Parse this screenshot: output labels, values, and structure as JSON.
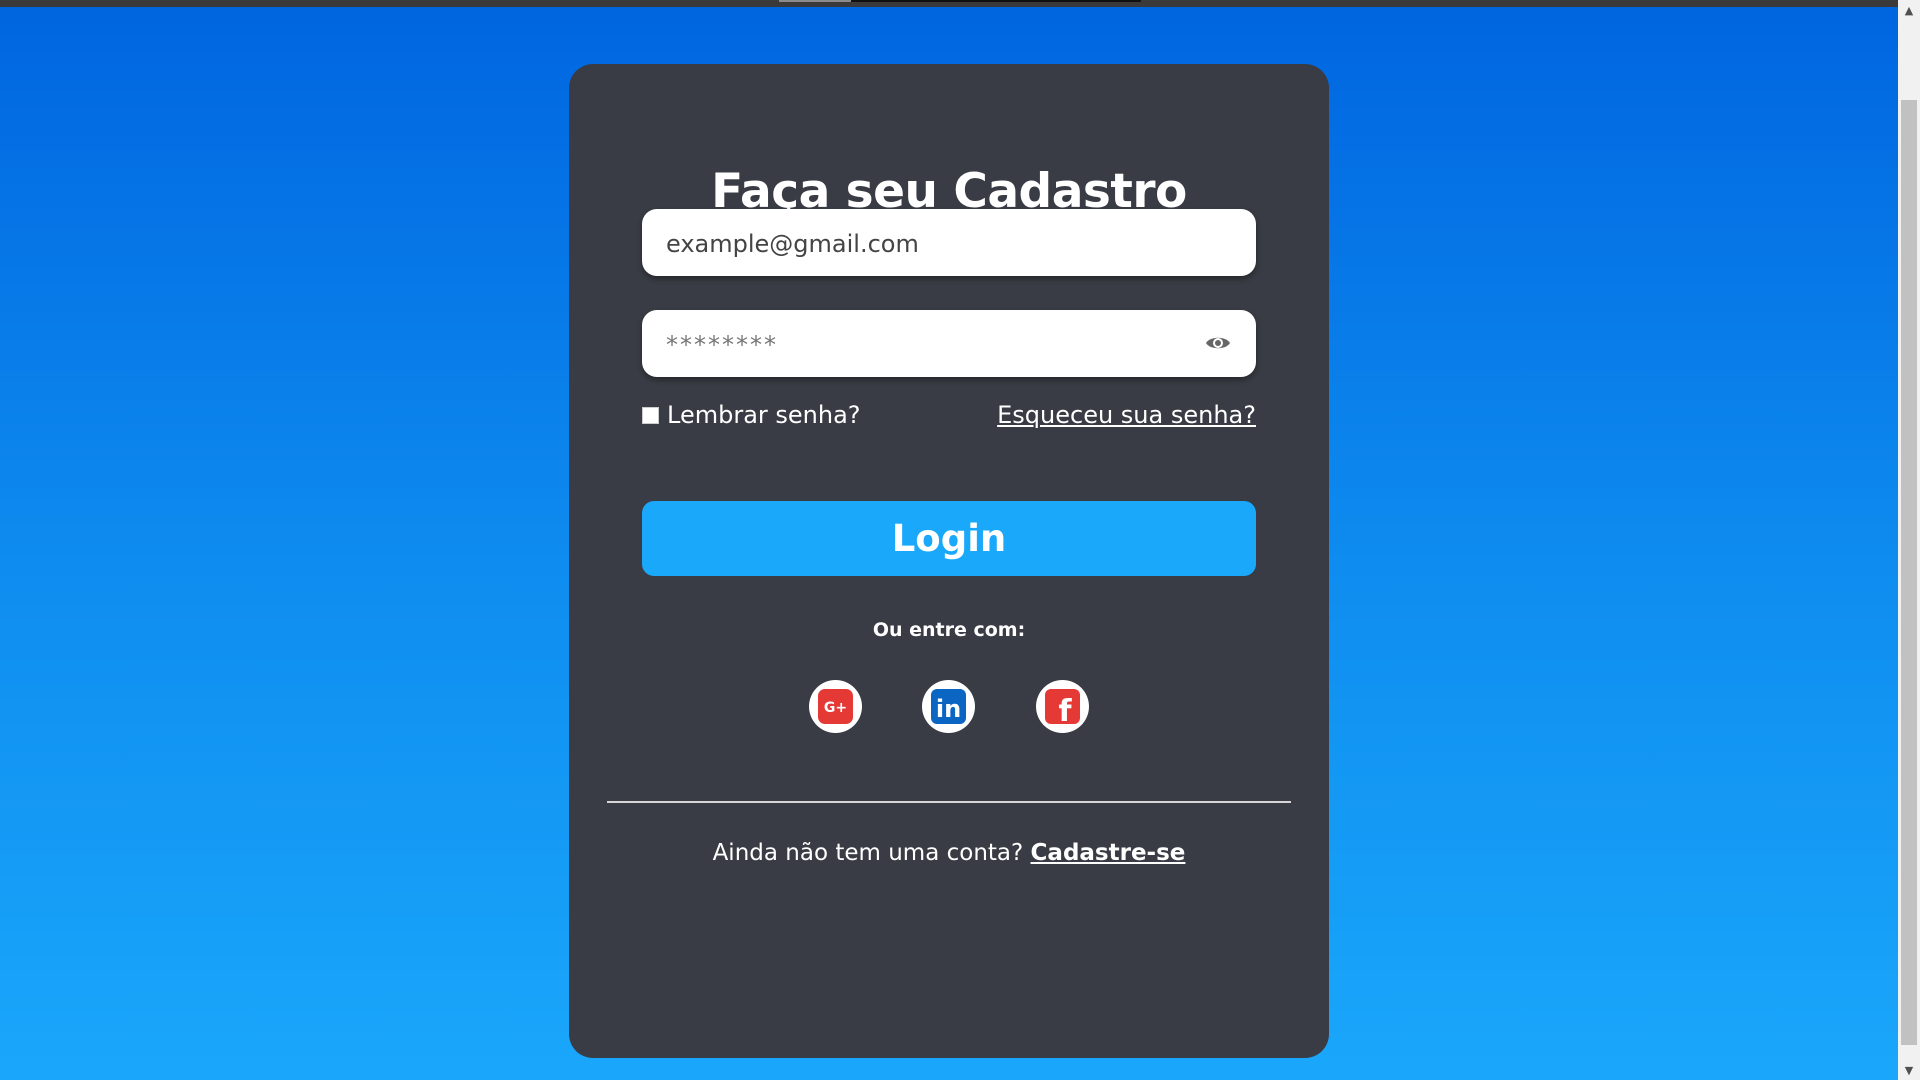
{
  "form": {
    "title": "Faça seu Cadastro",
    "email_placeholder": "example@gmail.com",
    "password_placeholder": "********",
    "remember_label": "Lembrar senha?",
    "forgot_link": "Esqueceu sua senha?",
    "login_button": "Login",
    "or_text": "Ou entre com:",
    "social_icons": [
      "google-plus-icon",
      "linkedin-icon",
      "facebook-icon"
    ],
    "signup_prompt": "Ainda não tem uma conta?",
    "signup_link": "Cadastre-se"
  },
  "colors": {
    "background_top": "#0065e0",
    "background_bottom": "#1aa7fb",
    "card": "#393c44",
    "button": "#1aa8fb",
    "google": "#e53935",
    "linkedin": "#0a66c2",
    "facebook": "#e53935"
  }
}
